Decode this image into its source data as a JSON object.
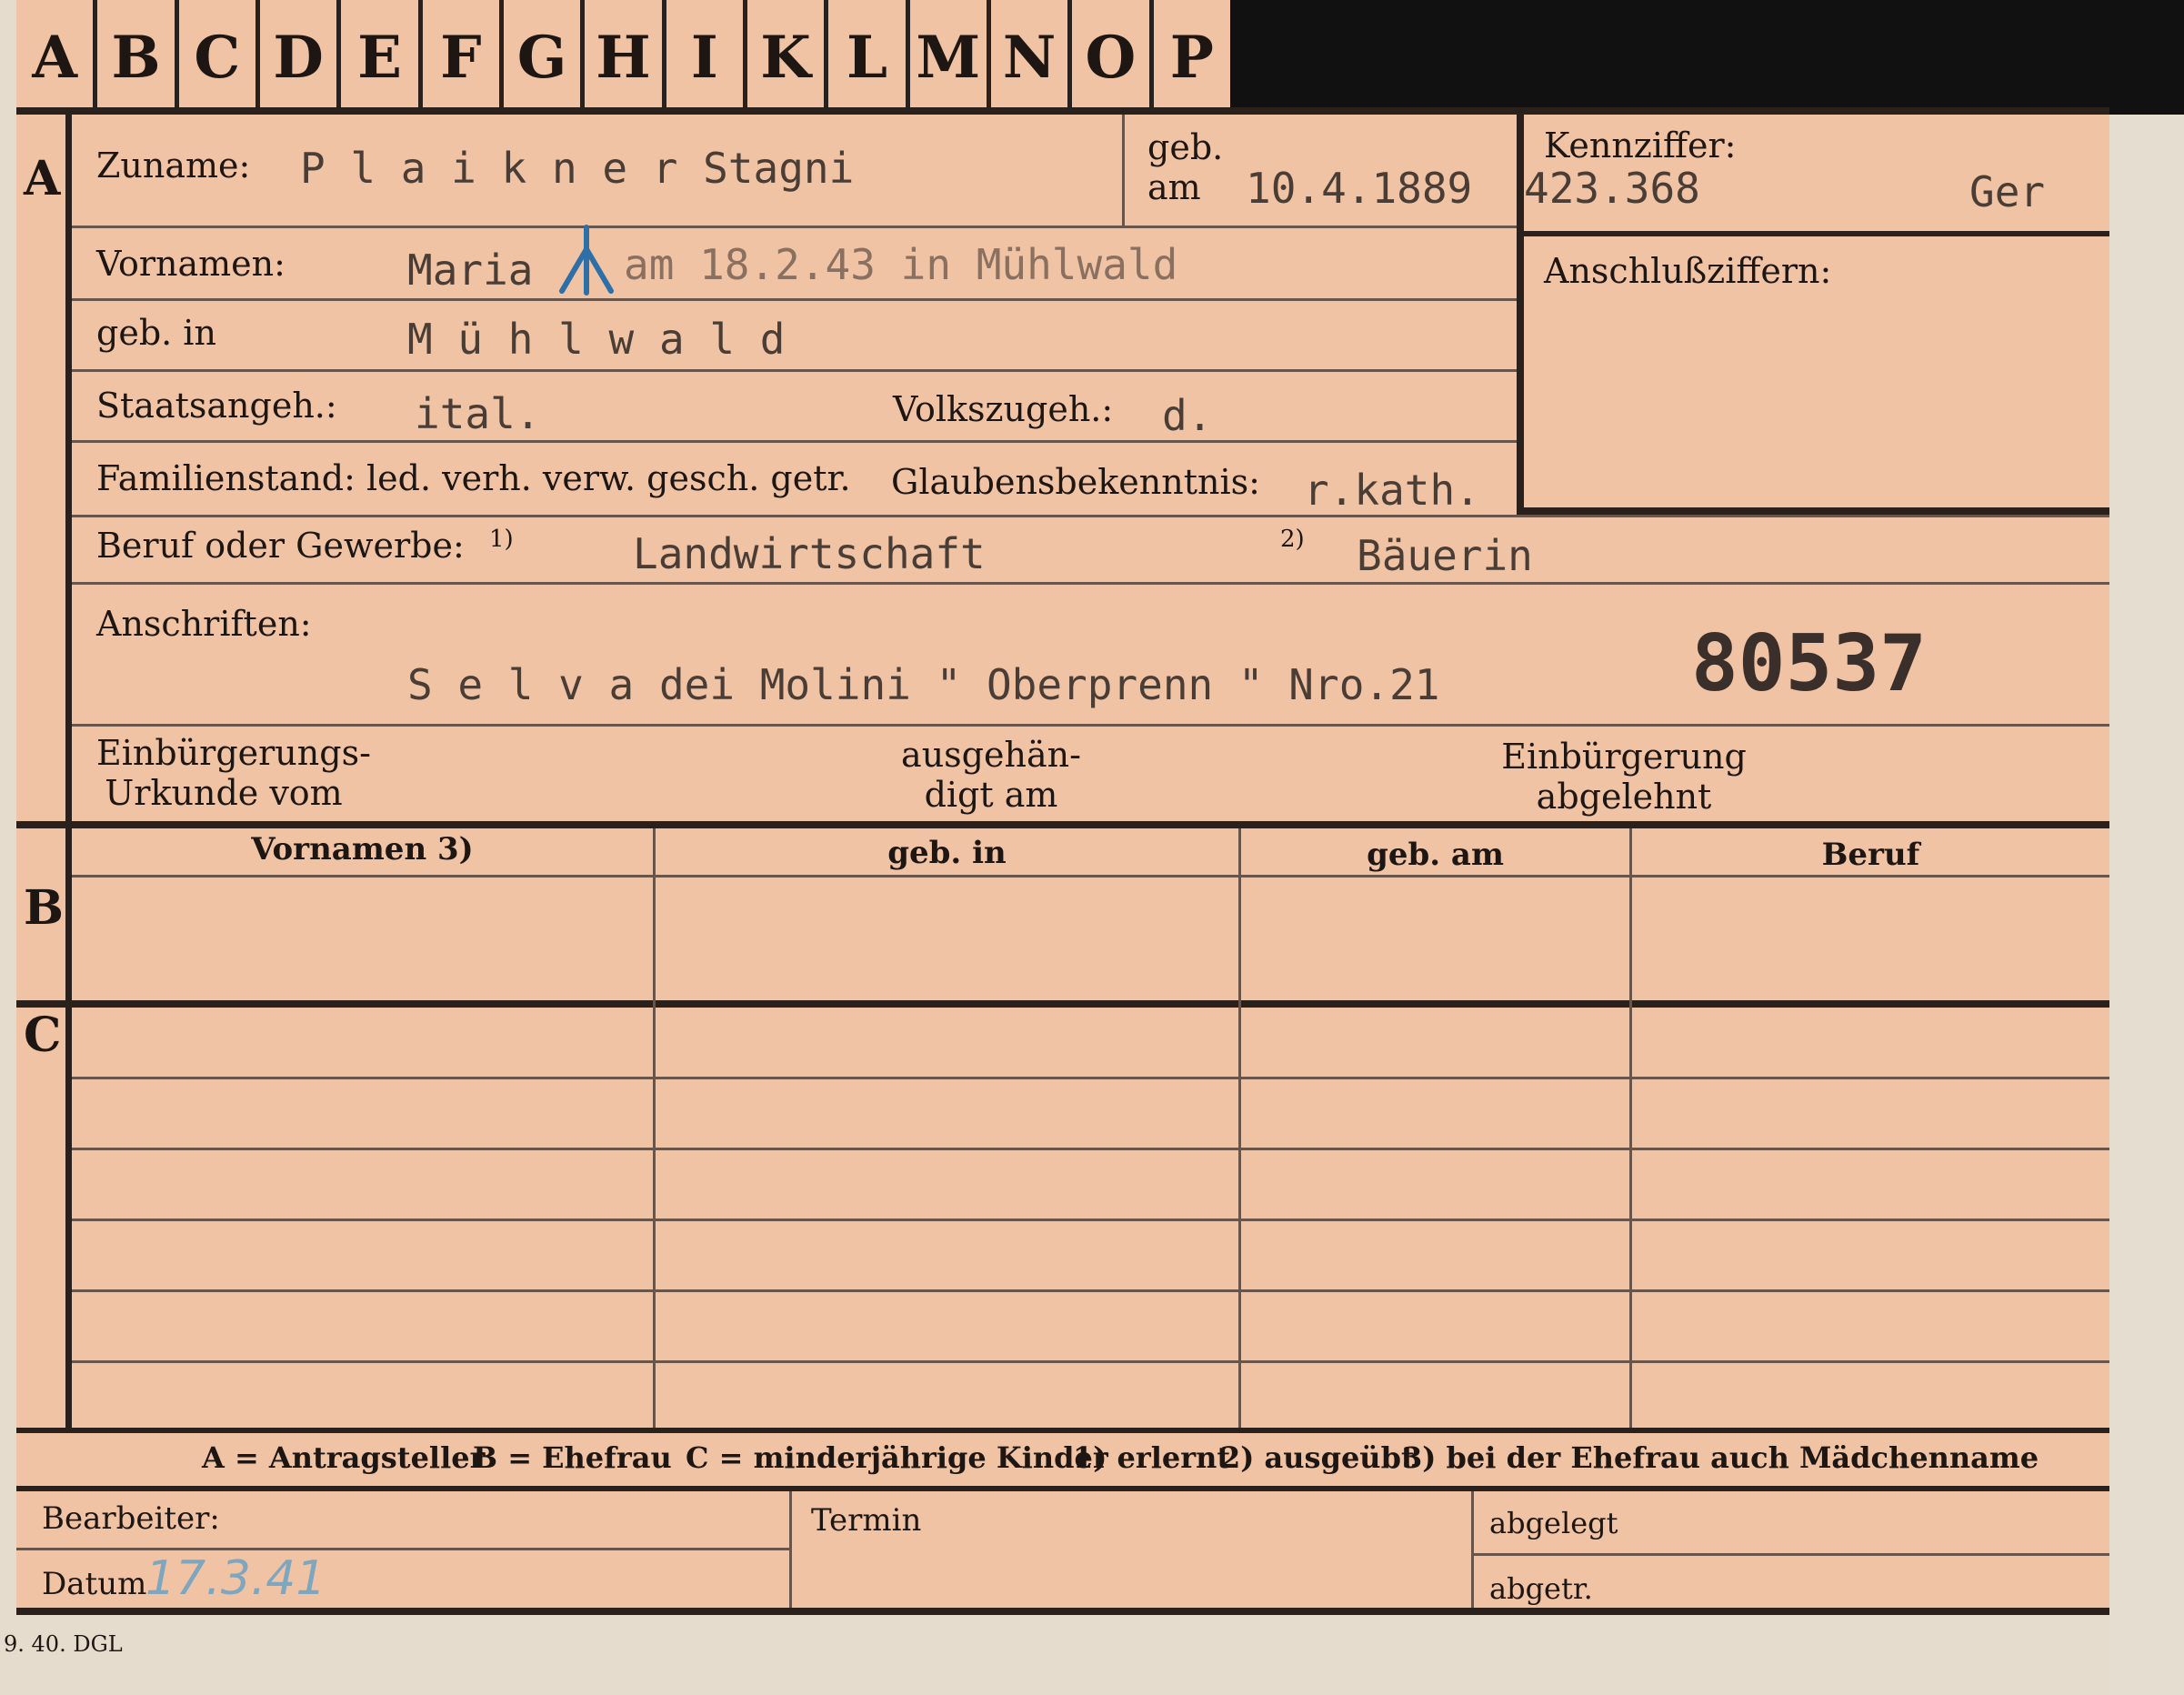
{
  "tabs": [
    "A",
    "B",
    "C",
    "D",
    "E",
    "F",
    "G",
    "H",
    "I",
    "K",
    "L",
    "M",
    "N",
    "O",
    "P"
  ],
  "sections": {
    "a": "A",
    "b": "B",
    "c": "C"
  },
  "fields": {
    "zuname_label": "Zuname:",
    "zuname_value": "P l a i k n e r  Stagni",
    "geb_am_label1": "geb.",
    "geb_am_label2": "am",
    "geb_am_value": "10.4.1889",
    "kennziffer_label": "Kennziffer:",
    "kennziffer_value": "423.368",
    "kennziffer_suffix": "Ger",
    "anschluss_label": "Anschlußziffern:",
    "vornamen_label": "Vornamen:",
    "vornamen_value": "Maria",
    "vornamen_note": "am 18.2.43 in Mühlwald",
    "gebin_label": "geb. in",
    "gebin_value": "M ü h l w a l d",
    "staats_label": "Staatsangeh.:",
    "staats_value": "ital.",
    "volks_label": "Volkszugeh.:",
    "volks_value": "d.",
    "familien_label": "Familienstand: led. verh. verw. gesch. getr.",
    "glauben_label": "Glaubensbekenntnis:",
    "glauben_value": "r.kath.",
    "beruf_label": "Beruf oder Gewerbe:",
    "beruf_mark1": "1)",
    "beruf_value1": "Landwirtschaft",
    "beruf_mark2": "2)",
    "beruf_value2": "Bäuerin",
    "anschriften_label": "Anschriften:",
    "anschriften_value": "S e l v a  dei Molini \" Oberprenn \" Nro.21",
    "stamp_number": "80537",
    "einb_urkunde_1": "Einbürgerungs-",
    "einb_urkunde_2": "Urkunde vom",
    "ausgeh_1": "ausgehän-",
    "ausgeh_2": "digt am",
    "einb_abgelehnt_1": "Einbürgerung",
    "einb_abgelehnt_2": "abgelehnt"
  },
  "table_headers": [
    "Vornamen 3)",
    "geb. in",
    "geb. am",
    "Beruf"
  ],
  "legend": {
    "a": "A = Antragsteller",
    "b": "B = Ehefrau",
    "c": "C = minderjährige Kinder",
    "n1": "1) erlernt",
    "n2": "2) ausgeübt",
    "n3": "3) bei der Ehefrau auch Mädchenname"
  },
  "footer": {
    "bearbeiter_label": "Bearbeiter:",
    "datum_label": "Datum",
    "datum_value": "17.3.41",
    "termin_label": "Termin",
    "abgelegt_label": "abgelegt",
    "abgetr_label": "abgetr.",
    "print_code": "9. 40. DGL"
  },
  "colors": {
    "card": "#efc3a4",
    "ink": "#1e1612",
    "typewriter": "#4a3d35",
    "pencil_blue": "#2f6fa8",
    "handwriting": "#7fa6bf"
  }
}
